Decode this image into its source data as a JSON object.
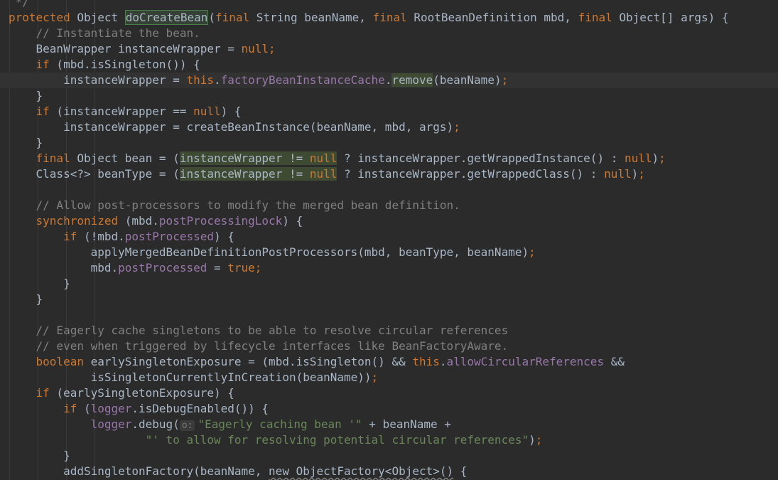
{
  "editor": {
    "lines": [
      {
        "indent": 1,
        "tokens": [
          {
            "t": "*/",
            "c": "cm"
          }
        ]
      },
      {
        "indent": 0,
        "tokens": [
          {
            "t": "protected",
            "c": "kw"
          },
          {
            "t": " Object "
          },
          {
            "t": "doCreateBean",
            "c": "hl-def"
          },
          {
            "t": "("
          },
          {
            "t": "final",
            "c": "kw"
          },
          {
            "t": " String beanName, "
          },
          {
            "t": "final",
            "c": "kw"
          },
          {
            "t": " RootBeanDefinition mbd, "
          },
          {
            "t": "final",
            "c": "kw"
          },
          {
            "t": " Object[] args) {"
          }
        ]
      },
      {
        "indent": 4,
        "tokens": [
          {
            "t": "// Instantiate the bean.",
            "c": "cm"
          }
        ]
      },
      {
        "indent": 4,
        "tokens": [
          {
            "t": "BeanWrapper instanceWrapper = "
          },
          {
            "t": "null",
            "c": "kw"
          },
          {
            "t": ";",
            "c": "kw"
          }
        ]
      },
      {
        "indent": 4,
        "tokens": [
          {
            "t": "if",
            "c": "kw"
          },
          {
            "t": " (mbd.isSingleton()) {"
          }
        ]
      },
      {
        "indent": 8,
        "current": true,
        "tokens": [
          {
            "t": "instanceWrapper = "
          },
          {
            "t": "this",
            "c": "kw"
          },
          {
            "t": "."
          },
          {
            "t": "factoryBeanInstanceCache",
            "c": "fd"
          },
          {
            "t": "."
          },
          {
            "t": "remove",
            "c": "hl-nn"
          },
          {
            "t": "(beanName)"
          },
          {
            "t": ";",
            "c": "kw"
          }
        ]
      },
      {
        "indent": 4,
        "tokens": [
          {
            "t": "}"
          }
        ]
      },
      {
        "indent": 4,
        "tokens": [
          {
            "t": "if",
            "c": "kw"
          },
          {
            "t": " (instanceWrapper == "
          },
          {
            "t": "null",
            "c": "kw"
          },
          {
            "t": ") {"
          }
        ]
      },
      {
        "indent": 8,
        "tokens": [
          {
            "t": "instanceWrapper = createBeanInstance(beanName, mbd, args)"
          },
          {
            "t": ";",
            "c": "kw"
          }
        ]
      },
      {
        "indent": 4,
        "tokens": [
          {
            "t": "}"
          }
        ]
      },
      {
        "indent": 4,
        "tokens": [
          {
            "t": "final",
            "c": "kw"
          },
          {
            "t": " Object bean = ("
          },
          {
            "t": "instanceWrapper != ",
            "c": "hl-nn"
          },
          {
            "t": "null",
            "c": "kw hl-nn"
          },
          {
            "t": " ? instanceWrapper.getWrappedInstance() : "
          },
          {
            "t": "null",
            "c": "kw"
          },
          {
            "t": ")"
          },
          {
            "t": ";",
            "c": "kw"
          }
        ]
      },
      {
        "indent": 4,
        "tokens": [
          {
            "t": "Class<?> beanType = ("
          },
          {
            "t": "instanceWrapper != ",
            "c": "hl-nn"
          },
          {
            "t": "null",
            "c": "kw hl-nn"
          },
          {
            "t": " ? instanceWrapper.getWrappedClass() : "
          },
          {
            "t": "null",
            "c": "kw"
          },
          {
            "t": ")"
          },
          {
            "t": ";",
            "c": "kw"
          }
        ]
      },
      {
        "indent": 0,
        "tokens": []
      },
      {
        "indent": 4,
        "tokens": [
          {
            "t": "// Allow post-processors to modify the merged bean definition.",
            "c": "cm"
          }
        ]
      },
      {
        "indent": 4,
        "tokens": [
          {
            "t": "synchronized",
            "c": "kw"
          },
          {
            "t": " (mbd."
          },
          {
            "t": "postProcessingLock",
            "c": "fd"
          },
          {
            "t": ") {"
          }
        ]
      },
      {
        "indent": 8,
        "tokens": [
          {
            "t": "if",
            "c": "kw"
          },
          {
            "t": " (!mbd."
          },
          {
            "t": "postProcessed",
            "c": "fd"
          },
          {
            "t": ") {"
          }
        ]
      },
      {
        "indent": 12,
        "tokens": [
          {
            "t": "applyMergedBeanDefinitionPostProcessors(mbd, beanType, beanName)"
          },
          {
            "t": ";",
            "c": "kw"
          }
        ]
      },
      {
        "indent": 12,
        "tokens": [
          {
            "t": "mbd."
          },
          {
            "t": "postProcessed",
            "c": "fd"
          },
          {
            "t": " = "
          },
          {
            "t": "true",
            "c": "kw"
          },
          {
            "t": ";",
            "c": "kw"
          }
        ]
      },
      {
        "indent": 8,
        "tokens": [
          {
            "t": "}"
          }
        ]
      },
      {
        "indent": 4,
        "tokens": [
          {
            "t": "}"
          }
        ]
      },
      {
        "indent": 0,
        "tokens": []
      },
      {
        "indent": 4,
        "tokens": [
          {
            "t": "// Eagerly cache singletons to be able to resolve circular references",
            "c": "cm"
          }
        ]
      },
      {
        "indent": 4,
        "tokens": [
          {
            "t": "// even when triggered by lifecycle interfaces like BeanFactoryAware.",
            "c": "cm"
          }
        ]
      },
      {
        "indent": 4,
        "tokens": [
          {
            "t": "boolean",
            "c": "kw"
          },
          {
            "t": " earlySingletonExposure = (mbd.isSingleton() && "
          },
          {
            "t": "this",
            "c": "kw"
          },
          {
            "t": "."
          },
          {
            "t": "allowCircularReferences",
            "c": "fd"
          },
          {
            "t": " &&"
          }
        ]
      },
      {
        "indent": 12,
        "tokens": [
          {
            "t": "isSingletonCurrentlyInCreation(beanName))"
          },
          {
            "t": ";",
            "c": "kw"
          }
        ]
      },
      {
        "indent": 4,
        "tokens": [
          {
            "t": "if",
            "c": "kw"
          },
          {
            "t": " (earlySingletonExposure) {"
          }
        ]
      },
      {
        "indent": 8,
        "tokens": [
          {
            "t": "if",
            "c": "kw"
          },
          {
            "t": " ("
          },
          {
            "t": "logger",
            "c": "fd"
          },
          {
            "t": ".isDebugEnabled()) {"
          }
        ]
      },
      {
        "indent": 12,
        "tokens": [
          {
            "t": "logger",
            "c": "fd"
          },
          {
            "t": ".debug("
          },
          {
            "t": "o:",
            "c": "hint"
          },
          {
            "t": "\"Eagerly caching bean '\"",
            "c": "str"
          },
          {
            "t": " + beanName +"
          }
        ]
      },
      {
        "indent": 20,
        "tokens": [
          {
            "t": "\"' to allow for resolving potential circular references\"",
            "c": "str"
          },
          {
            "t": ")"
          },
          {
            "t": ";",
            "c": "kw"
          }
        ]
      },
      {
        "indent": 8,
        "tokens": [
          {
            "t": "}"
          }
        ]
      },
      {
        "indent": 8,
        "tokens": [
          {
            "t": "addSingletonFactory(beanName, "
          },
          {
            "t": "new ObjectFactory<Object>()",
            "c": "ul"
          },
          {
            "t": " {"
          }
        ]
      }
    ]
  },
  "colors": {
    "background": "#2b2b2b",
    "default_text": "#a9b7c6",
    "keyword": "#cc7832",
    "comment": "#808080",
    "field": "#9876aa",
    "string": "#6a8759"
  }
}
